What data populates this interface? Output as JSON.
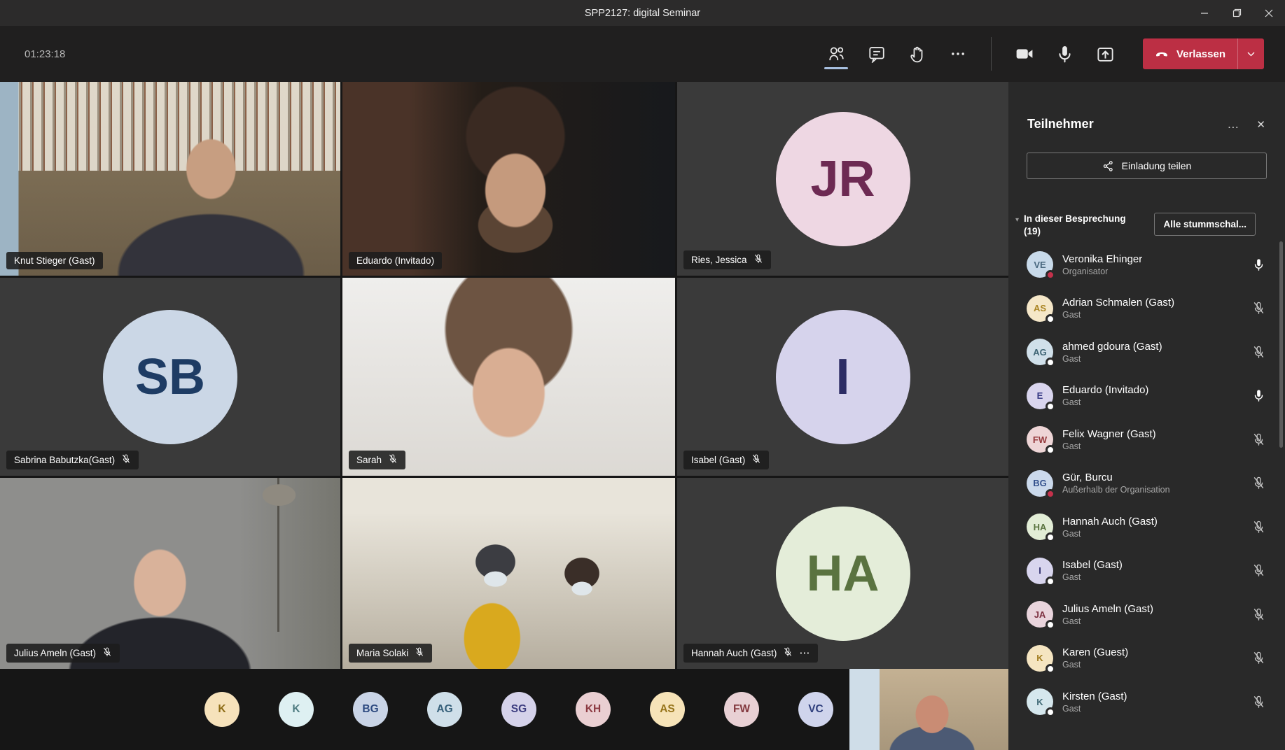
{
  "window": {
    "title": "SPP2127: digital Seminar"
  },
  "toolbar": {
    "timer": "01:23:18",
    "leave": {
      "label": "Verlassen"
    }
  },
  "stage": {
    "tiles": [
      {
        "id": "knut",
        "type": "video",
        "label": "Knut Stieger (Gast)",
        "muted": false
      },
      {
        "id": "eduardo",
        "type": "video",
        "label": "Eduardo (Invitado)",
        "muted": false
      },
      {
        "id": "jessica",
        "type": "avatar",
        "label": "Ries, Jessica",
        "muted": true,
        "initials": "JR",
        "bg": "#eed7e3",
        "fg": "#6d2a53"
      },
      {
        "id": "sabrina",
        "type": "avatar",
        "label": "Sabrina Babutzka(Gast)",
        "muted": true,
        "initials": "SB",
        "bg": "#cbd7e6",
        "fg": "#1e3c64"
      },
      {
        "id": "sarah",
        "type": "video",
        "label": "Sarah",
        "muted": true
      },
      {
        "id": "isabel",
        "type": "avatar",
        "label": "Isabel (Gast)",
        "muted": true,
        "initials": "I",
        "bg": "#d6d3ec",
        "fg": "#2c2c64"
      },
      {
        "id": "julius",
        "type": "video",
        "label": "Julius Ameln (Gast)",
        "muted": true
      },
      {
        "id": "maria",
        "type": "video",
        "label": "Maria Solaki",
        "muted": true
      },
      {
        "id": "hannah",
        "type": "avatar",
        "label": "Hannah Auch (Gast)",
        "muted": true,
        "more": true,
        "initials": "HA",
        "bg": "#e4edd9",
        "fg": "#5a7340"
      }
    ],
    "strip": [
      {
        "initials": "K",
        "bg": "#f6e2bb",
        "fg": "#8d6c16"
      },
      {
        "initials": "K",
        "bg": "#def0f2",
        "fg": "#4f7c82"
      },
      {
        "initials": "BG",
        "bg": "#c9d4e6",
        "fg": "#2e4a80"
      },
      {
        "initials": "AG",
        "bg": "#cfdfe9",
        "fg": "#36607a"
      },
      {
        "initials": "SG",
        "bg": "#d5d2ea",
        "fg": "#3d3d80"
      },
      {
        "initials": "KH",
        "bg": "#eacfd2",
        "fg": "#8c3a42"
      },
      {
        "initials": "AS",
        "bg": "#f6e3b8",
        "fg": "#96741a"
      },
      {
        "initials": "FW",
        "bg": "#e8d0d4",
        "fg": "#843a40"
      },
      {
        "initials": "VC",
        "bg": "#cfd4ec",
        "fg": "#2e3e7c"
      }
    ]
  },
  "sidebar": {
    "title": "Teilnehmer",
    "share_button": "Einladung teilen",
    "section_label": "In dieser Besprechung (19)",
    "mute_all": "Alle stummschal...",
    "participants": [
      {
        "initials": "VE",
        "name": "Veronika Ehinger",
        "role": "Organisator",
        "mic": "on",
        "dot": "red",
        "bg": "#c8daea",
        "fg": "#49687f"
      },
      {
        "initials": "AS",
        "name": "Adrian Schmalen (Gast)",
        "role": "Gast",
        "mic": "muted",
        "dot": "white",
        "bg": "#f5e7c8",
        "fg": "#ab8626"
      },
      {
        "initials": "AG",
        "name": "ahmed gdoura (Gast)",
        "role": "Gast",
        "mic": "muted",
        "dot": "white",
        "bg": "#d0e0ea",
        "fg": "#3f6575"
      },
      {
        "initials": "E",
        "name": "Eduardo (Invitado)",
        "role": "Gast",
        "mic": "on",
        "dot": "white",
        "bg": "#d9d5ee",
        "fg": "#373a85"
      },
      {
        "initials": "FW",
        "name": "Felix Wagner (Gast)",
        "role": "Gast",
        "mic": "muted",
        "dot": "white",
        "bg": "#eed5d6",
        "fg": "#95393c"
      },
      {
        "initials": "BG",
        "name": "Gür, Burcu",
        "role": "Außerhalb der Organisation",
        "mic": "muted",
        "dot": "red",
        "bg": "#cbd9ec",
        "fg": "#33508c"
      },
      {
        "initials": "HA",
        "name": "Hannah Auch (Gast)",
        "role": "Gast",
        "mic": "muted",
        "dot": "white",
        "bg": "#e2edd6",
        "fg": "#5a7440"
      },
      {
        "initials": "I",
        "name": "Isabel (Gast)",
        "role": "Gast",
        "mic": "muted",
        "dot": "white",
        "bg": "#d8d5ee",
        "fg": "#30306e"
      },
      {
        "initials": "JA",
        "name": "Julius Ameln (Gast)",
        "role": "Gast",
        "mic": "muted",
        "dot": "white",
        "bg": "#e9d4dc",
        "fg": "#7d3040"
      },
      {
        "initials": "K",
        "name": "Karen (Guest)",
        "role": "Gast",
        "mic": "muted",
        "dot": "white",
        "bg": "#f5e5c1",
        "fg": "#a07c1e"
      },
      {
        "initials": "K",
        "name": "Kirsten (Gast)",
        "role": "Gast",
        "mic": "muted",
        "dot": "white",
        "bg": "#d5e7ed",
        "fg": "#416b77"
      }
    ]
  },
  "icons": {
    "header_more": "…",
    "header_close": "✕",
    "caret": "▾",
    "tag_overflow": "⋯"
  },
  "colors": {
    "accent_red": "#bc2f44",
    "active_underline": "#a8c0e0"
  }
}
